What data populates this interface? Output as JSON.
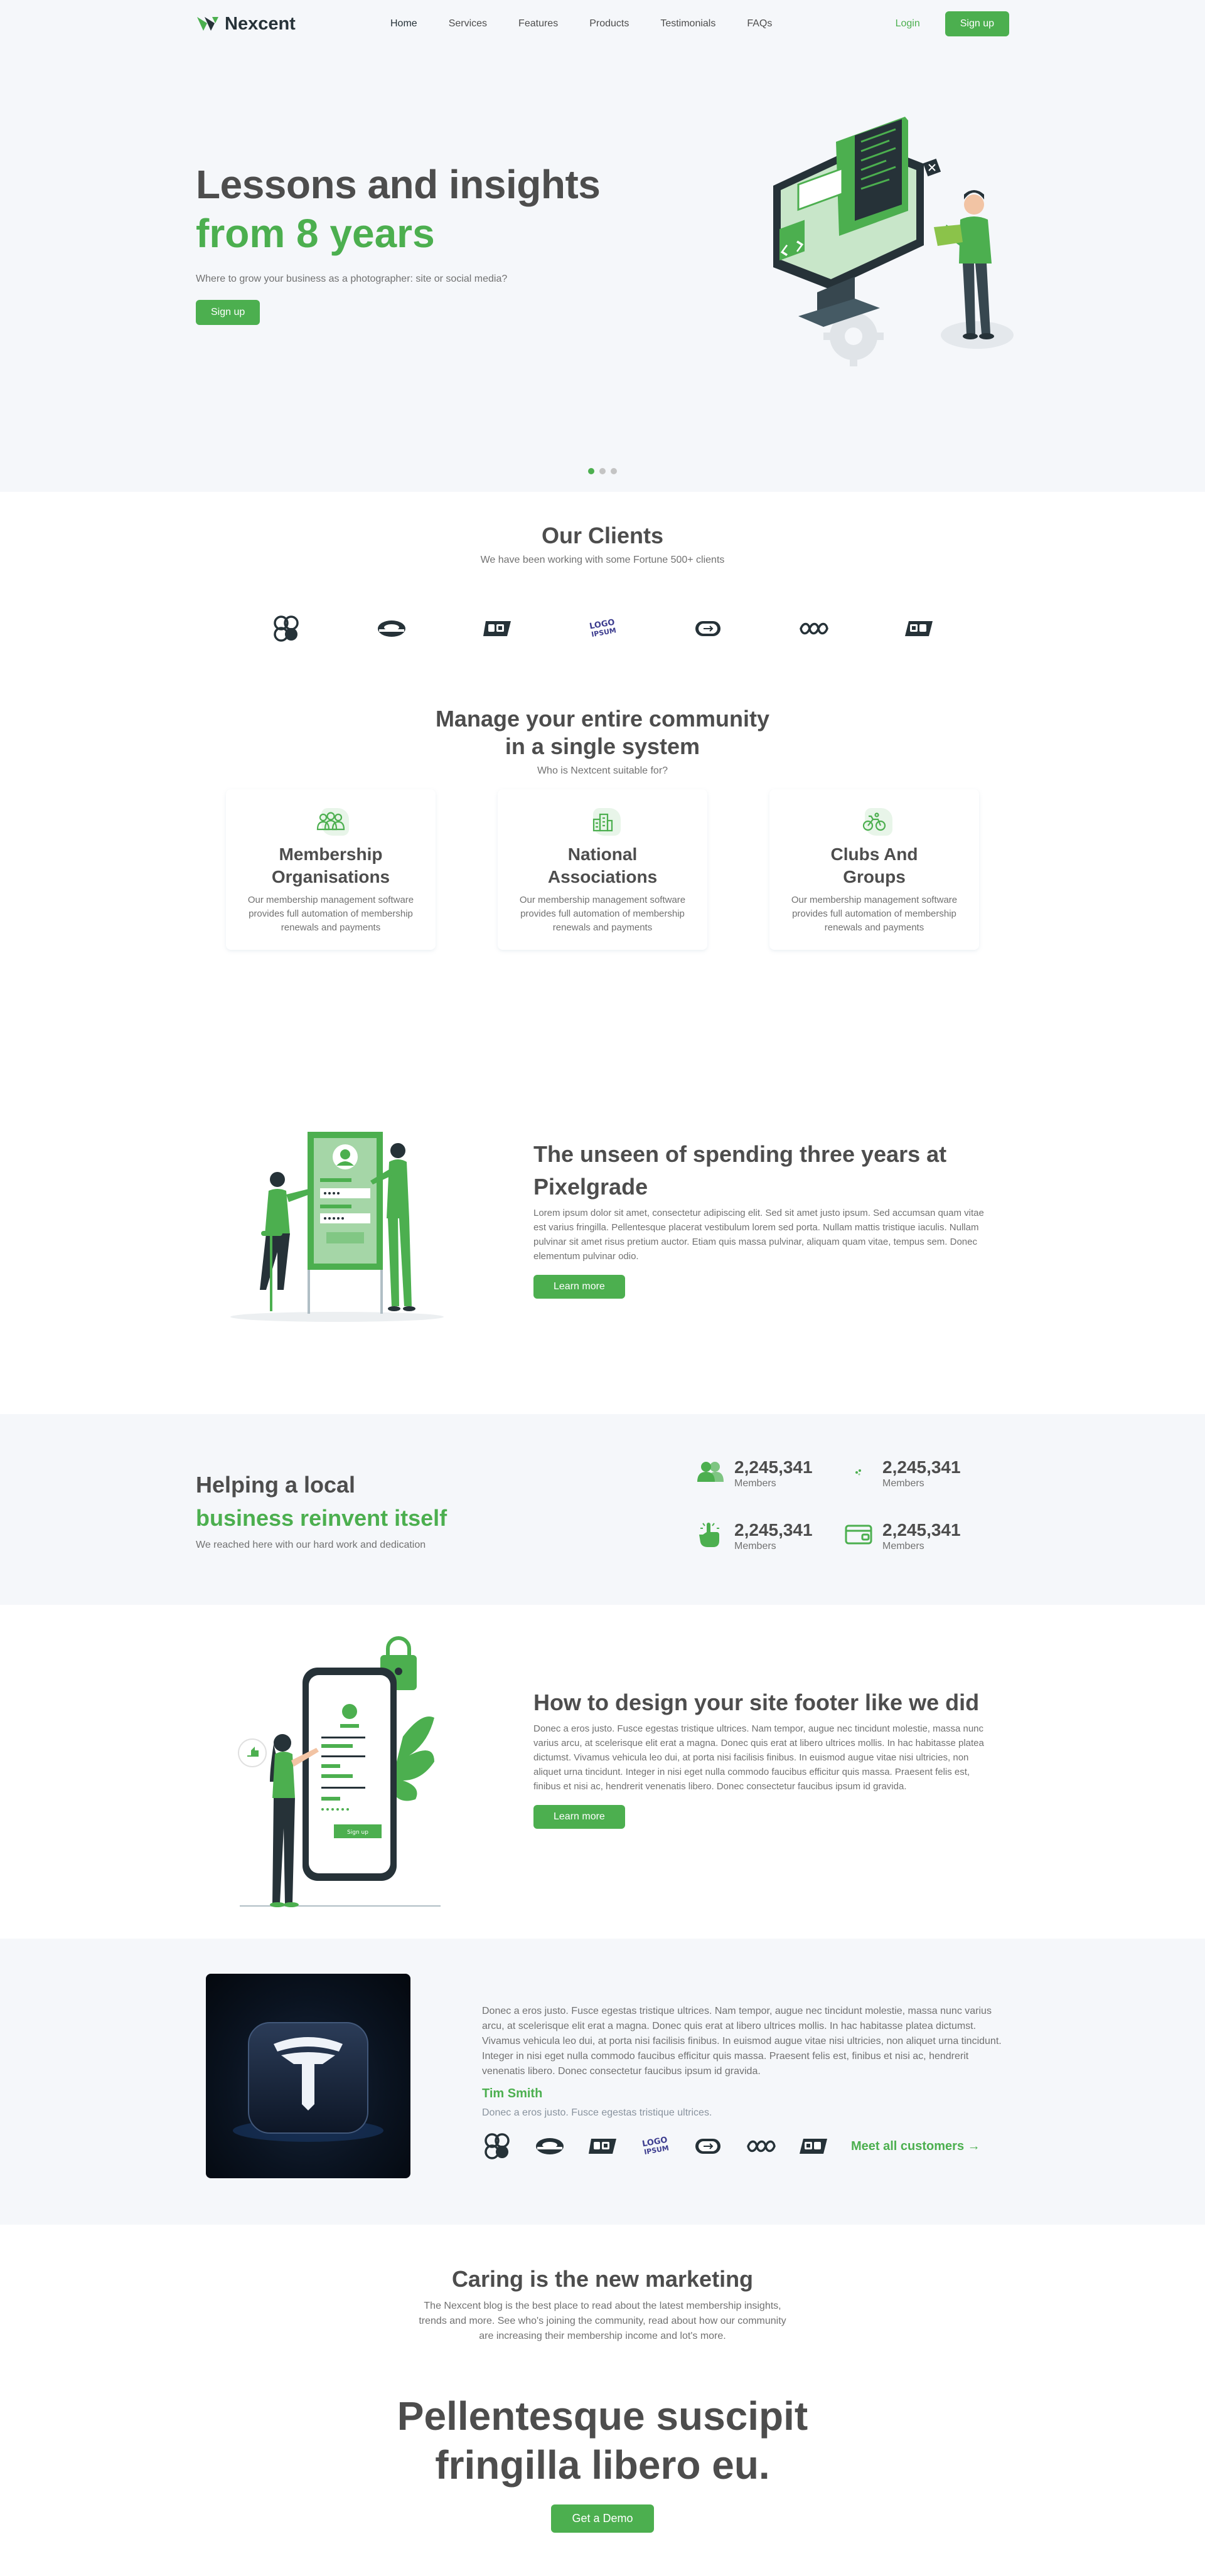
{
  "nav": {
    "brand": "Nexcent",
    "links": [
      "Home",
      "Services",
      "Features",
      "Products",
      "Testimonials",
      "FAQs"
    ],
    "login": "Login",
    "signup": "Sign up"
  },
  "hero": {
    "title": "Lessons and insights",
    "title_accent": "from 8 years",
    "subtitle": "Where to grow your business as a photographer: site or social media?",
    "cta": "Sign up",
    "carousel_active_index": 0,
    "carousel_count": 3
  },
  "clients": {
    "title": "Our Clients",
    "subtitle": "We have been working with some Fortune 500+ clients"
  },
  "community": {
    "title_line1": "Manage your entire community",
    "title_line2": "in a single system",
    "subtitle": "Who is Nextcent suitable for?",
    "cards": [
      {
        "title_line1": "Membership",
        "title_line2": "Organisations",
        "desc": "Our membership management software provides full automation of membership renewals and payments",
        "icon": "members-icon"
      },
      {
        "title_line1": "National",
        "title_line2": "Associations",
        "desc": "Our membership management software provides full automation of membership renewals and payments",
        "icon": "building-icon"
      },
      {
        "title_line1": "Clubs And",
        "title_line2": "Groups",
        "desc": "Our membership management software provides full automation of membership renewals and payments",
        "icon": "bike-icon"
      }
    ]
  },
  "feature1": {
    "title": "The unseen of spending three years at Pixelgrade",
    "body": "Lorem ipsum dolor sit amet, consectetur adipiscing elit. Sed sit amet justo ipsum. Sed accumsan quam vitae est varius fringilla. Pellentesque placerat vestibulum lorem sed porta. Nullam mattis tristique iaculis. Nullam pulvinar sit amet risus pretium auctor. Etiam quis massa pulvinar, aliquam quam vitae, tempus sem. Donec elementum pulvinar odio.",
    "cta": "Learn more"
  },
  "stats": {
    "title": "Helping a local",
    "title_accent": "business reinvent itself",
    "subtitle": "We reached here with our hard work and dedication",
    "items": [
      {
        "value": "2,245,341",
        "label": "Members",
        "icon": "members-icon"
      },
      {
        "value": "2,245,341",
        "label": "Members",
        "icon": "handshake-icon"
      },
      {
        "value": "2,245,341",
        "label": "Members",
        "icon": "click-icon"
      },
      {
        "value": "2,245,341",
        "label": "Members",
        "icon": "payment-icon"
      }
    ]
  },
  "feature2": {
    "title": "How to design your site footer like we did",
    "body": "Donec a eros justo. Fusce egestas tristique ultrices. Nam tempor, augue nec tincidunt molestie, massa nunc varius arcu, at scelerisque elit erat a magna. Donec quis erat at libero ultrices mollis. In hac habitasse platea dictumst. Vivamus vehicula leo dui, at porta nisi facilisis finibus. In euismod augue vitae nisi ultricies, non aliquet urna tincidunt. Integer in nisi eget nulla commodo faucibus efficitur quis massa. Praesent felis est, finibus et nisi ac, hendrerit venenatis libero. Donec consectetur faucibus ipsum id gravida.",
    "cta": "Learn more",
    "button_label": "Sign up"
  },
  "testimonial": {
    "body": "Donec a eros justo. Fusce egestas tristique ultrices. Nam tempor, augue nec tincidunt molestie, massa nunc varius arcu, at scelerisque elit erat a magna. Donec quis erat at libero ultrices mollis. In hac habitasse platea dictumst. Vivamus vehicula leo dui, at porta nisi facilisis finibus. In euismod augue vitae nisi ultricies, non aliquet urna tincidunt. Integer in nisi eget nulla commodo faucibus efficitur quis massa. Praesent felis est, finibus et nisi ac, hendrerit venenatis libero. Donec consectetur faucibus ipsum id gravida.",
    "name": "Tim Smith",
    "role": "Donec a eros justo. Fusce egestas tristique ultrices.",
    "link": "Meet all customers →"
  },
  "blog": {
    "title": "Caring is the new marketing",
    "subtitle": "The Nexcent blog is the best place to read about the latest membership insights, trends and more. See who's joining the community, read about how our community are increasing their membership income and lot's more."
  },
  "cta": {
    "title_line1": "Pellentesque suscipit",
    "title_line2": "fringilla libero eu.",
    "button": "Get a Demo"
  },
  "colors": {
    "primary": "#4CAF4F",
    "text": "#4D4D4D",
    "muted": "#717171",
    "silver": "#F5F7FA",
    "dark": "#263238"
  },
  "logo_icons": [
    "client-logo-1-icon",
    "client-logo-2-icon",
    "client-logo-3-icon",
    "client-logo-4-icon",
    "client-logo-5-icon",
    "client-logo-6-icon",
    "client-logo-7-icon"
  ],
  "logo_badge_text": "LOGO IPSUM"
}
